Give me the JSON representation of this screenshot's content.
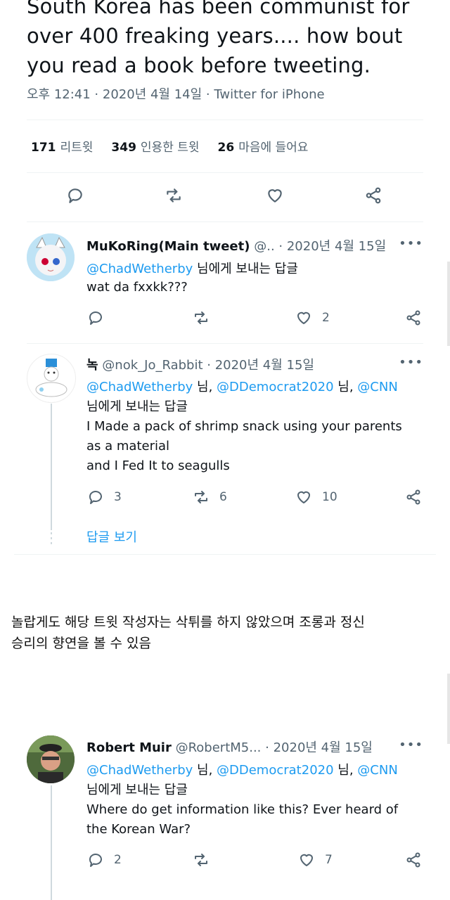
{
  "main_tweet": {
    "text_lines": [
      "South Korea has been communist for",
      "over 400 freaking years.... how bout",
      "you read a book before tweeting."
    ],
    "meta": "오후 12:41 · 2020년 4월 14일 · Twitter for iPhone",
    "stats": {
      "retweets_count": "171",
      "retweets_label": "리트윗",
      "quotes_count": "349",
      "quotes_label": "인용한 트윗",
      "likes_count": "26",
      "likes_label": "마음에 들어요"
    }
  },
  "replies": [
    {
      "name": "MuKoRing(Main tweet)",
      "handle": "@..",
      "date": "· 2020년 4월 15일",
      "more": "•••",
      "reply_to_line": {
        "mentions": "@ChadWetherby",
        "suffix": " 님에게 보내는 답글"
      },
      "body": [
        "wat da fxxkk???"
      ],
      "reply_count": "",
      "retweet_count": "",
      "like_count": "2"
    },
    {
      "name": "녹",
      "handle": "@nok_Jo_Rabbit",
      "date": "· 2020년 4월 15일",
      "more": "•••",
      "reply_to_line": {
        "mention1": "@ChadWetherby",
        "sep1": " 님, ",
        "mention2": "@DDemocrat2020",
        "sep2": " 님, ",
        "mention3": "@CNN"
      },
      "reply_to_suffix": "님에게 보내는 답글",
      "body": [
        "I Made a pack of shrimp snack using your parents",
        "as a material",
        "and I Fed It to seagulls"
      ],
      "reply_count": "3",
      "retweet_count": "6",
      "like_count": "10",
      "show_replies": "답글 보기"
    },
    {
      "name": "Robert Muir",
      "handle": "@RobertM5...",
      "date": "· 2020년 4월 15일",
      "more": "•••",
      "reply_to_line": {
        "mention1": "@ChadWetherby",
        "sep1": " 님, ",
        "mention2": "@DDemocrat2020",
        "sep2": " 님, ",
        "mention3": "@CNN"
      },
      "reply_to_suffix": "님에게 보내는 답글",
      "body": [
        "Where do get information like this? Ever heard of",
        "the Korean War?"
      ],
      "reply_count": "2",
      "retweet_count": "",
      "like_count": "7"
    }
  ],
  "caption_lines": [
    "놀랍게도 해당 트윗 작성자는 삭튀를 하지 않았으며 조롱과 정신",
    "승리의 향연을 볼 수 있음"
  ],
  "icons": [
    "reply-icon",
    "retweet-icon",
    "like-icon",
    "share-icon",
    "more-icon"
  ],
  "colors": {
    "link": "#1d9bf0",
    "muted": "#536471",
    "text": "#0f1419"
  }
}
